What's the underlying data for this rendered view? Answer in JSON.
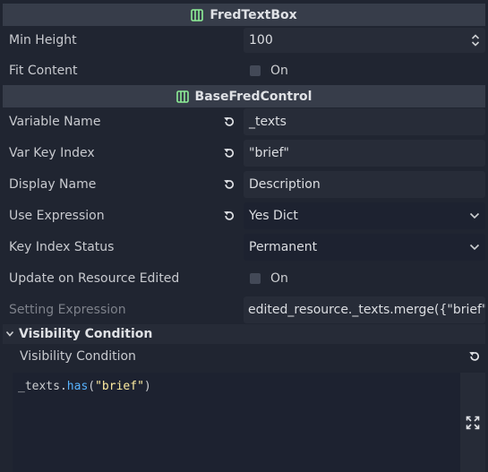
{
  "sections": {
    "fred_text_box": {
      "title": "FredTextBox",
      "icon": "class-icon"
    },
    "base_fred_control": {
      "title": "BaseFredControl",
      "icon": "class-icon"
    }
  },
  "props": {
    "min_height": {
      "label": "Min Height",
      "value": "100"
    },
    "fit_content": {
      "label": "Fit Content",
      "value": "On",
      "checked": false
    },
    "variable_name": {
      "label": "Variable Name",
      "value": "_texts"
    },
    "var_key_index": {
      "label": "Var Key Index",
      "value": "\"brief\""
    },
    "display_name": {
      "label": "Display Name",
      "value": "Description"
    },
    "use_expression": {
      "label": "Use Expression",
      "value": "Yes Dict"
    },
    "key_index_status": {
      "label": "Key Index Status",
      "value": "Permanent"
    },
    "update_on_resource_edited": {
      "label": "Update on Resource Edited",
      "value": "On",
      "checked": false
    },
    "setting_expression": {
      "label": "Setting Expression",
      "value": "edited_resource._texts.merge({\"brief\":v"
    }
  },
  "visibility": {
    "group_title": "Visibility Condition",
    "label": "Visibility Condition",
    "code": {
      "obj": "_texts",
      "dot": ".",
      "fn": "has",
      "open": "(",
      "str": "\"brief\"",
      "close": ")"
    }
  },
  "colors": {
    "accent_icon": "#8eef97",
    "header_bg": "#373d4a",
    "bg": "#202531",
    "function": "#57b3ff",
    "string": "#ffeda1"
  }
}
